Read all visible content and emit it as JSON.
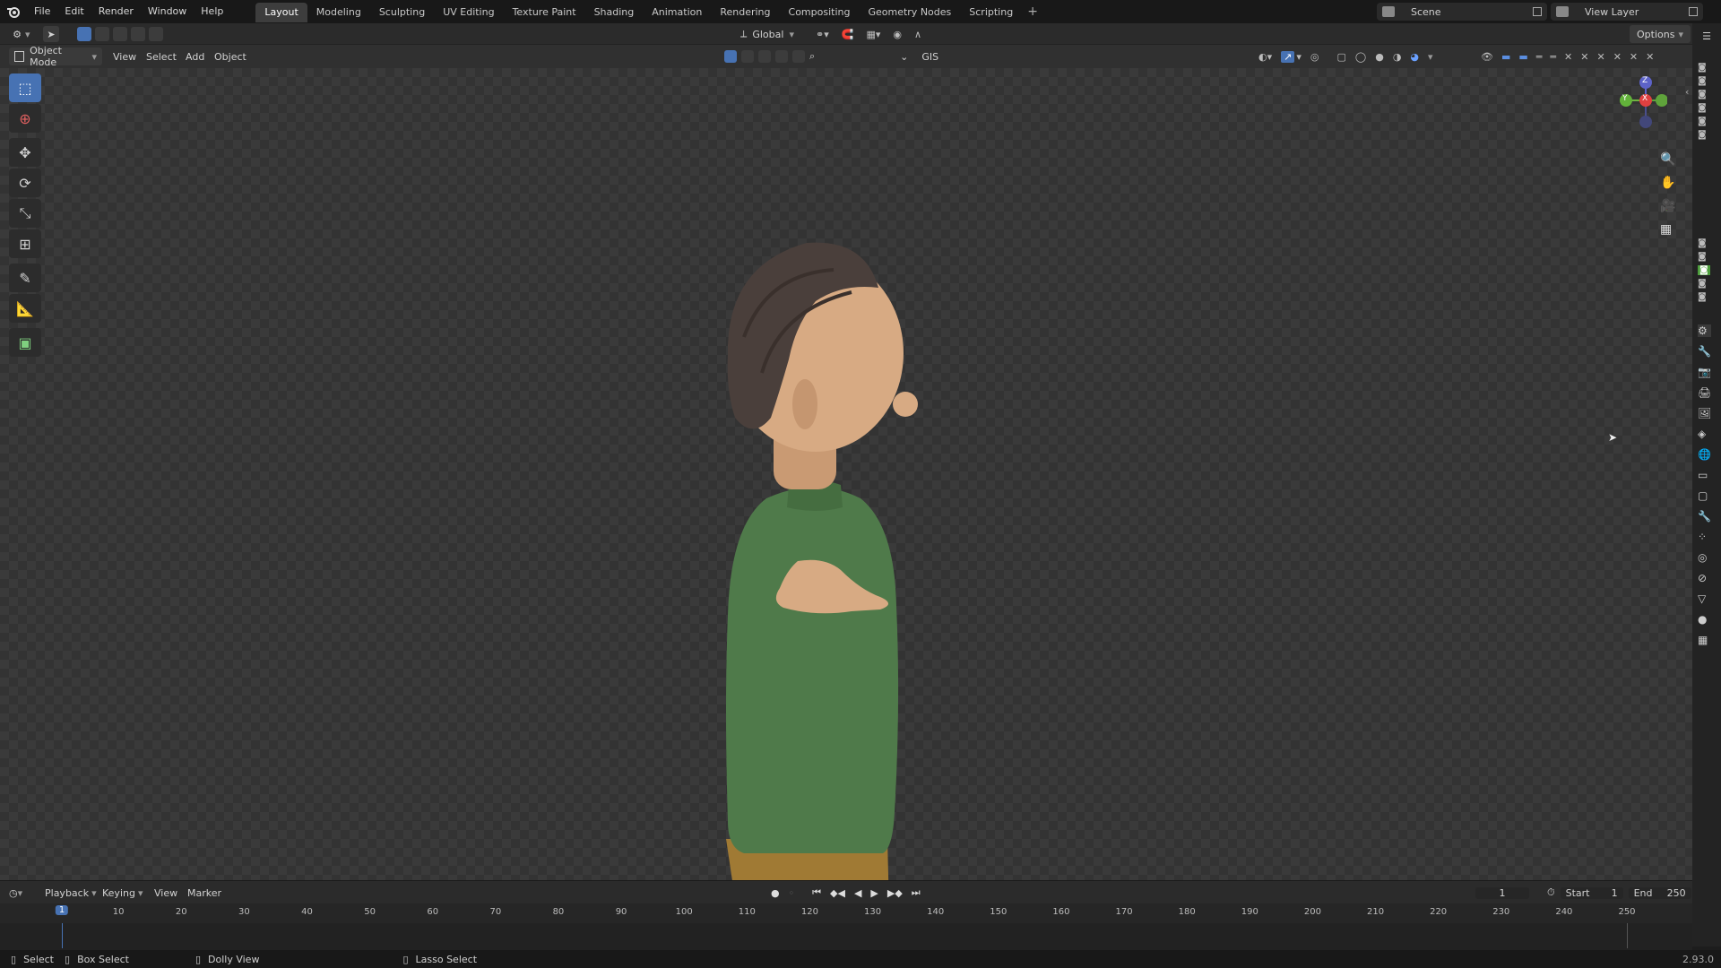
{
  "menus": [
    "File",
    "Edit",
    "Render",
    "Window",
    "Help"
  ],
  "workspaces": [
    {
      "label": "Layout",
      "active": true
    },
    {
      "label": "Modeling"
    },
    {
      "label": "Sculpting"
    },
    {
      "label": "UV Editing"
    },
    {
      "label": "Texture Paint"
    },
    {
      "label": "Shading"
    },
    {
      "label": "Animation"
    },
    {
      "label": "Rendering"
    },
    {
      "label": "Compositing"
    },
    {
      "label": "Geometry Nodes"
    },
    {
      "label": "Scripting"
    }
  ],
  "add_workspace": "+",
  "scene": {
    "label": "Scene"
  },
  "view_layer": {
    "label": "View Layer"
  },
  "header1": {
    "orientation": "Global",
    "options": "Options"
  },
  "header2": {
    "mode": "Object Mode",
    "view": "View",
    "select": "Select",
    "add": "Add",
    "object": "Object",
    "gis": "GIS"
  },
  "gizmo": {
    "z": "Z",
    "y": "Y",
    "x": "X"
  },
  "timeline": {
    "playback": "Playback",
    "keying": "Keying",
    "view": "View",
    "marker": "Marker",
    "current_frame": "1",
    "start_label": "Start",
    "start": "1",
    "end_label": "End",
    "end": "250",
    "ticks": [
      "1",
      "10",
      "20",
      "30",
      "40",
      "50",
      "60",
      "70",
      "80",
      "90",
      "100",
      "110",
      "120",
      "130",
      "140",
      "150",
      "160",
      "170",
      "180",
      "190",
      "200",
      "210",
      "220",
      "230",
      "240",
      "250"
    ]
  },
  "status": {
    "select": "Select",
    "box_select": "Box Select",
    "dolly_view": "Dolly View",
    "lasso_select": "Lasso Select",
    "version": "2.93.0"
  },
  "colors": {
    "accent": "#4772b3",
    "sweater": "#4f7a4a",
    "pants": "#a07a34",
    "skin": "#d7aa83",
    "hair": "#4a3f3b"
  }
}
